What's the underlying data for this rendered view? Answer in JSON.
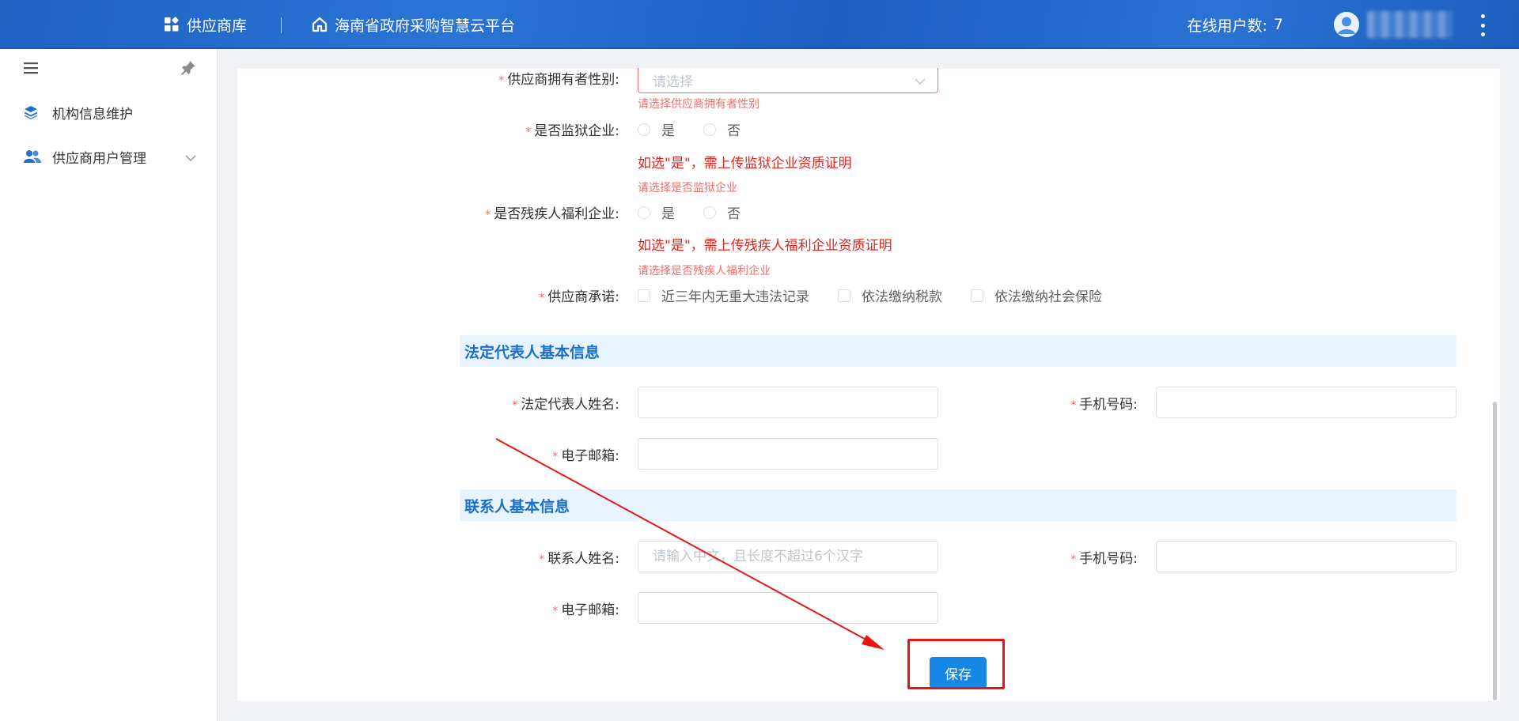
{
  "header": {
    "nav_supplier": "供应商库",
    "nav_platform": "海南省政府采购智慧云平台",
    "online_label": "在线用户数:",
    "online_count": "7",
    "icons": [
      "grid-icon",
      "home-icon",
      "user-avatar-icon",
      "more-vertical-icon"
    ]
  },
  "sidebar": {
    "items": [
      {
        "label": "机构信息维护",
        "icon": "layers-icon"
      },
      {
        "label": "供应商用户管理",
        "icon": "users-icon"
      }
    ],
    "icons": [
      "menu-icon",
      "pin-icon",
      "chevron-down-icon"
    ]
  },
  "form": {
    "owner_gender": {
      "label": "供应商拥有者性别:",
      "placeholder": "请选择",
      "error": "请选择供应商拥有者性别"
    },
    "prison": {
      "label": "是否监狱企业:",
      "option_yes": "是",
      "option_no": "否",
      "notice": "如选\"是\"，需上传监狱企业资质证明",
      "error": "请选择是否监狱企业"
    },
    "disabled": {
      "label": "是否残疾人福利企业:",
      "option_yes": "是",
      "option_no": "否",
      "notice": "如选\"是\"，需上传残疾人福利企业资质证明",
      "error": "请选择是否残疾人福利企业"
    },
    "commitment": {
      "label": "供应商承诺:",
      "options": [
        "近三年内无重大违法记录",
        "依法缴纳税款",
        "依法缴纳社会保险"
      ]
    }
  },
  "legal_section": {
    "title": "法定代表人基本信息",
    "name_label": "法定代表人姓名:",
    "phone_label": "手机号码:",
    "email_label": "电子邮箱:"
  },
  "contact_section": {
    "title": "联系人基本信息",
    "name_label": "联系人姓名:",
    "name_placeholder": "请输入中文，且长度不超过6个汉字",
    "phone_label": "手机号码:",
    "email_label": "电子邮箱:"
  },
  "actions": {
    "save_label": "保存"
  },
  "colors": {
    "header": "#1e62c2",
    "accent": "#1787e6",
    "error": "#f56c6c",
    "notice": "#e8211a",
    "annotation": "#e81515"
  }
}
